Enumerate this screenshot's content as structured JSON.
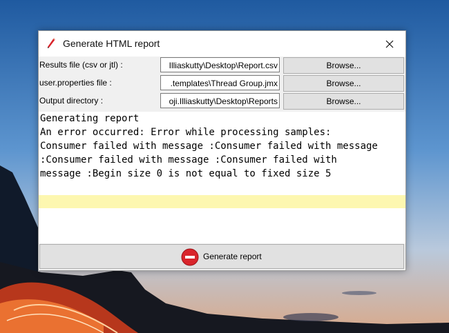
{
  "window": {
    "title": "Generate HTML report"
  },
  "fields": [
    {
      "label": "Results file (csv or jtl) :",
      "value": "Illiaskutty\\Desktop\\Report.csv",
      "button": "Browse..."
    },
    {
      "label": "user.properties file :",
      "value": ".templates\\Thread Group.jmx",
      "button": "Browse..."
    },
    {
      "label": "Output directory :",
      "value": "oji.Illiaskutty\\Desktop\\Reports",
      "button": "Browse..."
    }
  ],
  "log": {
    "text": "Generating report\nAn error occurred: Error while processing samples:\nConsumer failed with message :Consumer failed with message\n:Consumer failed with message :Consumer failed with\nmessage :Begin size 0 is not equal to fixed size 5"
  },
  "generate_button": {
    "label": "Generate report"
  },
  "colors": {
    "highlight": "#fdf7b0",
    "stop_icon": "#d9242b"
  }
}
